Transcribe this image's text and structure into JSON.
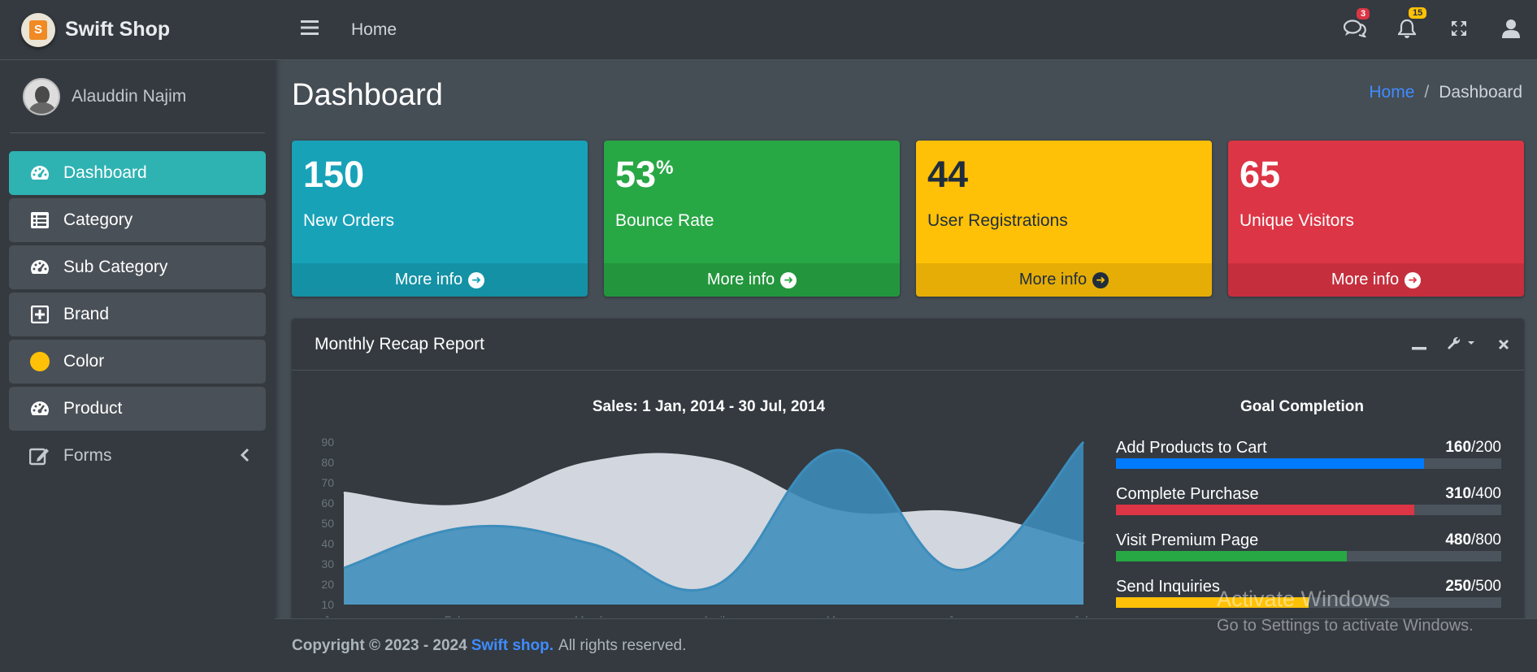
{
  "brand": {
    "name": "Swift Shop",
    "logo_letter": "S"
  },
  "user": {
    "name": "Alauddin Najim"
  },
  "sidebar": {
    "items": [
      {
        "label": "Dashboard",
        "icon": "tachometer-icon",
        "active": true
      },
      {
        "label": "Category",
        "icon": "list-icon"
      },
      {
        "label": "Sub Category",
        "icon": "tachometer-icon"
      },
      {
        "label": "Brand",
        "icon": "plus-square-icon"
      },
      {
        "label": "Color",
        "icon": "circle-icon"
      },
      {
        "label": "Product",
        "icon": "tachometer-icon"
      },
      {
        "label": "Forms",
        "icon": "edit-icon"
      }
    ]
  },
  "topbar": {
    "home": "Home",
    "messages_count": "3",
    "notifications_count": "15"
  },
  "page": {
    "title": "Dashboard",
    "breadcrumb": {
      "home": "Home",
      "sep": "/",
      "current": "Dashboard"
    }
  },
  "stats": [
    {
      "value": "150",
      "suffix": "",
      "label": "New Orders",
      "more": "More info",
      "color": "#17a2b8"
    },
    {
      "value": "53",
      "suffix": "%",
      "label": "Bounce Rate",
      "more": "More info",
      "color": "#28a745"
    },
    {
      "value": "44",
      "suffix": "",
      "label": "User Registrations",
      "more": "More info",
      "color": "#ffc107"
    },
    {
      "value": "65",
      "suffix": "",
      "label": "Unique Visitors",
      "more": "More info",
      "color": "#dc3545"
    }
  ],
  "report": {
    "title": "Monthly Recap Report",
    "chart_title": "Sales: 1 Jan, 2014 - 30 Jul, 2014",
    "goal_title": "Goal Completion",
    "goals": [
      {
        "label": "Add Products to Cart",
        "done": "160",
        "total": "/200",
        "fraction": 0.8,
        "color": "#007bff"
      },
      {
        "label": "Complete Purchase",
        "done": "310",
        "total": "/400",
        "fraction": 0.775,
        "color": "#dc3545"
      },
      {
        "label": "Visit Premium Page",
        "done": "480",
        "total": "/800",
        "fraction": 0.6,
        "color": "#28a745"
      },
      {
        "label": "Send Inquiries",
        "done": "250",
        "total": "/500",
        "fraction": 0.5,
        "color": "#ffc107"
      }
    ]
  },
  "chart_data": {
    "type": "area",
    "title": "Sales: 1 Jan, 2014 - 30 Jul, 2014",
    "categories": [
      "January",
      "February",
      "March",
      "April",
      "May",
      "June",
      "July"
    ],
    "y_ticks": [
      "90",
      "80",
      "70",
      "60",
      "50",
      "40",
      "30",
      "20",
      "10"
    ],
    "ylim": [
      10,
      90
    ],
    "grid": false,
    "series": [
      {
        "values": [
          65,
          59,
          80,
          81,
          56,
          55,
          40
        ],
        "color": "#d2d6de"
      },
      {
        "values": [
          28,
          48,
          40,
          19,
          86,
          27,
          90
        ],
        "color": "#3c8dbc"
      }
    ]
  },
  "footer": {
    "copyright": "Copyright © 2023 - 2024",
    "brand": "Swift shop.",
    "rights": "All rights reserved."
  },
  "watermark": {
    "line1": "Activate Windows",
    "line2": "Go to Settings to activate Windows."
  }
}
